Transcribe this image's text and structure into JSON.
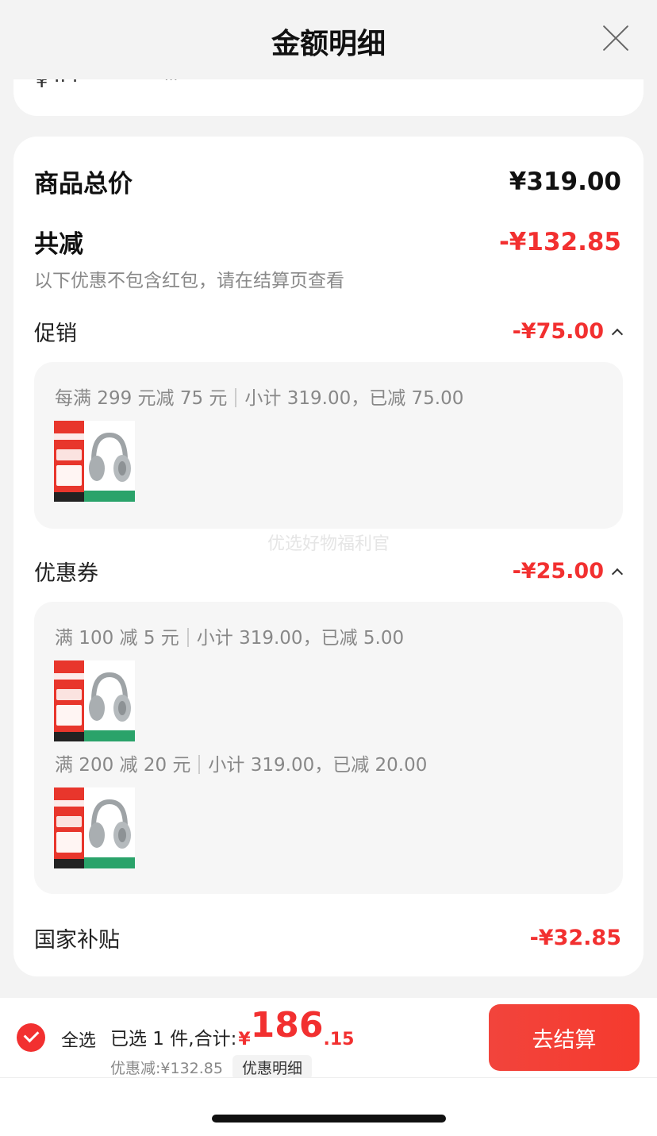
{
  "header": {
    "title": "金额明细"
  },
  "summary": {
    "total_label": "商品总价",
    "total_value": "¥319.00",
    "reduce_label": "共减",
    "reduce_value": "-¥132.85",
    "note": "以下优惠不包含红包，请在结算页查看"
  },
  "promotion": {
    "label": "促销",
    "value": "-¥75.00",
    "rules": [
      {
        "rule": "每满 299 元减 75 元",
        "detail": "小计 319.00，已减 75.00"
      }
    ]
  },
  "coupon": {
    "label": "优惠券",
    "value": "-¥25.00",
    "rules": [
      {
        "rule": "满 100 减 5 元",
        "detail": "小计 319.00，已减 5.00"
      },
      {
        "rule": "满 200 减 20 元",
        "detail": "小计 319.00，已减 20.00"
      }
    ]
  },
  "subsidy": {
    "label": "国家补贴",
    "value": "-¥32.85"
  },
  "watermark": "优选好物福利官",
  "footer": {
    "select_all": "全选",
    "selected_text": "已选 1 件,合计:",
    "currency": "¥",
    "total_int": "186",
    "total_dec": ".15",
    "discount_text": "优惠减:¥132.85",
    "detail_button": "优惠明细",
    "checkout_button": "去结算"
  },
  "colors": {
    "accent": "#f23030",
    "background": "#f3f3f3"
  },
  "icons": {
    "close": "close-icon",
    "checkbox": "check-circle-icon",
    "expand": "chevron-up-icon",
    "product": "headphones-icon"
  }
}
